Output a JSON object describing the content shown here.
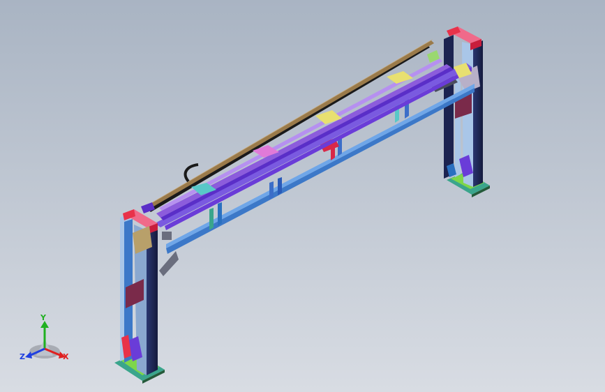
{
  "viewport": {
    "background_top": "#a9b4c3",
    "background_bottom": "#d8dce3"
  },
  "triad": {
    "x_label": "X",
    "y_label": "Y",
    "z_label": "Z",
    "x_color": "#e02020",
    "y_color": "#20b020",
    "z_color": "#2040e0"
  },
  "model": {
    "colors": {
      "post_navy": "#1c2350",
      "post_light": "#a9c6e8",
      "cap_red": "#e8324a",
      "cap_pink": "#f06a8a",
      "foot_green": "#7ed64a",
      "foot_teal": "#3aa58c",
      "beam_blue": "#3c78c8",
      "beam_violet": "#6a3cd8",
      "rail_purple": "#8c5cdc",
      "brace_pink": "#e07ad8",
      "cable_black": "#1a1a1a",
      "rail_tan": "#9a7a4a",
      "slider_teal": "#58c8c8",
      "slider_yellow": "#e8e070",
      "clamp_red": "#d82848",
      "bracket_gray": "#6a6e7e"
    }
  }
}
